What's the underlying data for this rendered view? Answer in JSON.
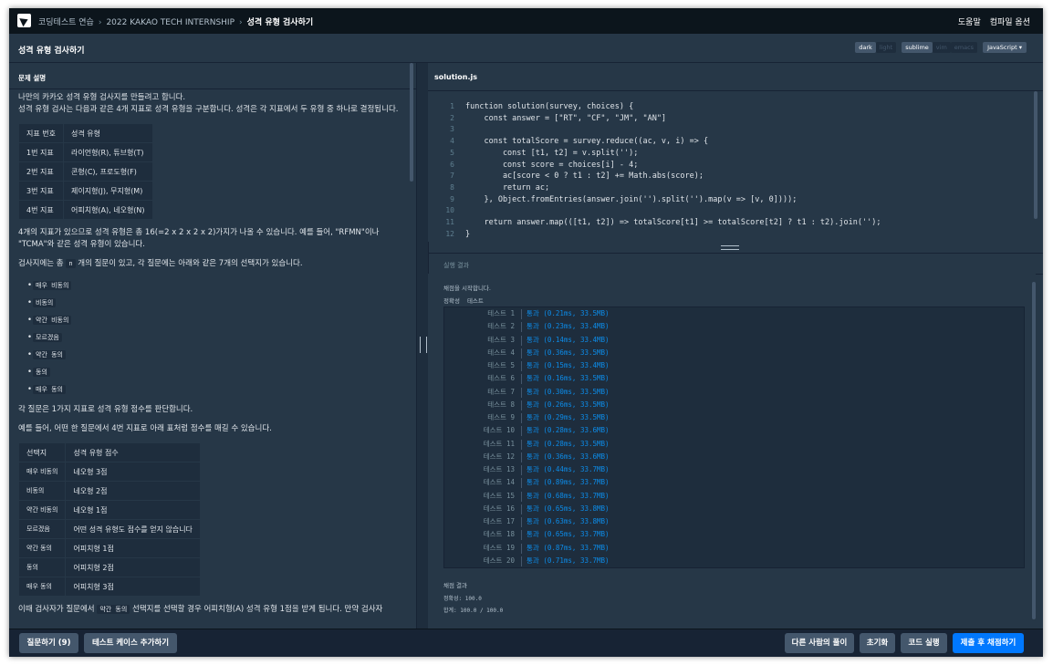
{
  "breadcrumb": [
    "코딩테스트 연습",
    "2022 KAKAO TECH INTERNSHIP",
    "성격 유형 검사하기"
  ],
  "nav": {
    "help": "도움말",
    "compile_options": "컴파일 옵션"
  },
  "page_title": "성격 유형 검사하기",
  "editor_toggles": {
    "theme": [
      "dark",
      "light"
    ],
    "theme_selected": "dark",
    "keymap": [
      "sublime",
      "vim",
      "emacs"
    ],
    "keymap_selected": "sublime",
    "language": "JavaScript"
  },
  "problem": {
    "heading": "문제 설명",
    "p1": "나만의 카카오 성격 유형 검사지를 만들려고 합니다.",
    "p2": "성격 유형 검사는 다음과 같은 4개 지표로 성격 유형을 구분합니다. 성격은 각 지표에서 두 유형 중 하나로 결정됩니다.",
    "indicator_table": {
      "headers": [
        "지표 번호",
        "성격 유형"
      ],
      "rows": [
        [
          "1번 지표",
          "라이언형(R), 튜브형(T)"
        ],
        [
          "2번 지표",
          "콘형(C), 프로도형(F)"
        ],
        [
          "3번 지표",
          "제이지형(J), 무지형(M)"
        ],
        [
          "4번 지표",
          "어피치형(A), 네오형(N)"
        ]
      ]
    },
    "p3": "4개의 지표가 있으므로 성격 유형은 총 16(=2 x 2 x 2 x 2)가지가 나올 수 있습니다. 예를 들어, \"RFMN\"이나 \"TCMA\"와 같은 성격 유형이 있습니다.",
    "p4_before": "검사지에는 총",
    "p4_code": "n",
    "p4_after": "개의 질문이 있고, 각 질문에는 아래와 같은 7개의 선택지가 있습니다.",
    "choices": [
      "매우 비동의",
      "비동의",
      "약간 비동의",
      "모르겠음",
      "약간 동의",
      "동의",
      "매우 동의"
    ],
    "p5": "각 질문은 1가지 지표로 성격 유형 점수를 판단합니다.",
    "p6": "예를 들어, 어떤 한 질문에서 4번 지표로 아래 표처럼 점수를 매길 수 있습니다.",
    "score_table": {
      "headers": [
        "선택지",
        "성격 유형 점수"
      ],
      "rows": [
        [
          "매우 비동의",
          "네오형 3점"
        ],
        [
          "비동의",
          "네오형 2점"
        ],
        [
          "약간 비동의",
          "네오형 1점"
        ],
        [
          "모르겠음",
          "어떤 성격 유형도 점수를 얻지 않습니다"
        ],
        [
          "약간 동의",
          "어피치형 1점"
        ],
        [
          "동의",
          "어피치형 2점"
        ],
        [
          "매우 동의",
          "어피치형 3점"
        ]
      ]
    },
    "p7_before": "이때 검사자가 질문에서",
    "p7_code": "약간 동의",
    "p7_after": "선택지를 선택할 경우 어피치형(A) 성격 유형 1점을 받게 됩니다. 만약 검사자"
  },
  "editor": {
    "filename": "solution.js",
    "lines": [
      "function solution(survey, choices) {",
      "    const answer = [\"RT\", \"CF\", \"JM\", \"AN\"]",
      "",
      "    const totalScore = survey.reduce((ac, v, i) => {",
      "        const [t1, t2] = v.split('');",
      "        const score = choices[i] - 4;",
      "        ac[score < 0 ? t1 : t2] += Math.abs(score);",
      "        return ac;",
      "    }, Object.fromEntries(answer.join('').split('').map(v => [v, 0])));",
      "",
      "    return answer.map(([t1, t2]) => totalScore[t1] >= totalScore[t2] ? t1 : t2).join('');",
      "}"
    ]
  },
  "results": {
    "heading": "실행 결과",
    "start_msg": "채점을 시작합니다.",
    "columns": [
      "정확성",
      "테스트"
    ],
    "tests": [
      {
        "name": "테스트 1",
        "result": "통과 (0.21ms, 33.5MB)"
      },
      {
        "name": "테스트 2",
        "result": "통과 (0.23ms, 33.4MB)"
      },
      {
        "name": "테스트 3",
        "result": "통과 (0.14ms, 33.4MB)"
      },
      {
        "name": "테스트 4",
        "result": "통과 (0.36ms, 33.5MB)"
      },
      {
        "name": "테스트 5",
        "result": "통과 (0.15ms, 33.4MB)"
      },
      {
        "name": "테스트 6",
        "result": "통과 (0.16ms, 33.5MB)"
      },
      {
        "name": "테스트 7",
        "result": "통과 (0.30ms, 33.5MB)"
      },
      {
        "name": "테스트 8",
        "result": "통과 (0.26ms, 33.5MB)"
      },
      {
        "name": "테스트 9",
        "result": "통과 (0.29ms, 33.5MB)"
      },
      {
        "name": "테스트 10",
        "result": "통과 (0.28ms, 33.6MB)"
      },
      {
        "name": "테스트 11",
        "result": "통과 (0.28ms, 33.5MB)"
      },
      {
        "name": "테스트 12",
        "result": "통과 (0.36ms, 33.6MB)"
      },
      {
        "name": "테스트 13",
        "result": "통과 (0.44ms, 33.7MB)"
      },
      {
        "name": "테스트 14",
        "result": "통과 (0.89ms, 33.7MB)"
      },
      {
        "name": "테스트 15",
        "result": "통과 (0.68ms, 33.7MB)"
      },
      {
        "name": "테스트 16",
        "result": "통과 (0.65ms, 33.8MB)"
      },
      {
        "name": "테스트 17",
        "result": "통과 (0.63ms, 33.8MB)"
      },
      {
        "name": "테스트 18",
        "result": "통과 (0.65ms, 33.7MB)"
      },
      {
        "name": "테스트 19",
        "result": "통과 (0.87ms, 33.7MB)"
      },
      {
        "name": "테스트 20",
        "result": "통과 (0.71ms, 33.7MB)"
      }
    ],
    "summary_heading": "채점 결과",
    "accuracy": "정확성: 100.0",
    "total": "합계: 100.0 / 100.0"
  },
  "footer": {
    "ask_button": "질문하기 (9)",
    "add_testcase_button": "테스트 케이스 추가하기",
    "others_solutions_button": "다른 사람의 풀이",
    "reset_button": "초기화",
    "run_button": "코드 실행",
    "submit_button": "제출 후 채점하기"
  },
  "colors": {
    "background": "#263747",
    "nav": "#0c151c",
    "panel": "#1e2d3d",
    "footer": "#172334",
    "accent": "#0078ff",
    "pass": "#0c8ce9"
  },
  "icons": {
    "logo": "programmers-logo-icon",
    "breadcrumb_separator": "chevron-right-icon",
    "select": "chevron-down-icon"
  }
}
